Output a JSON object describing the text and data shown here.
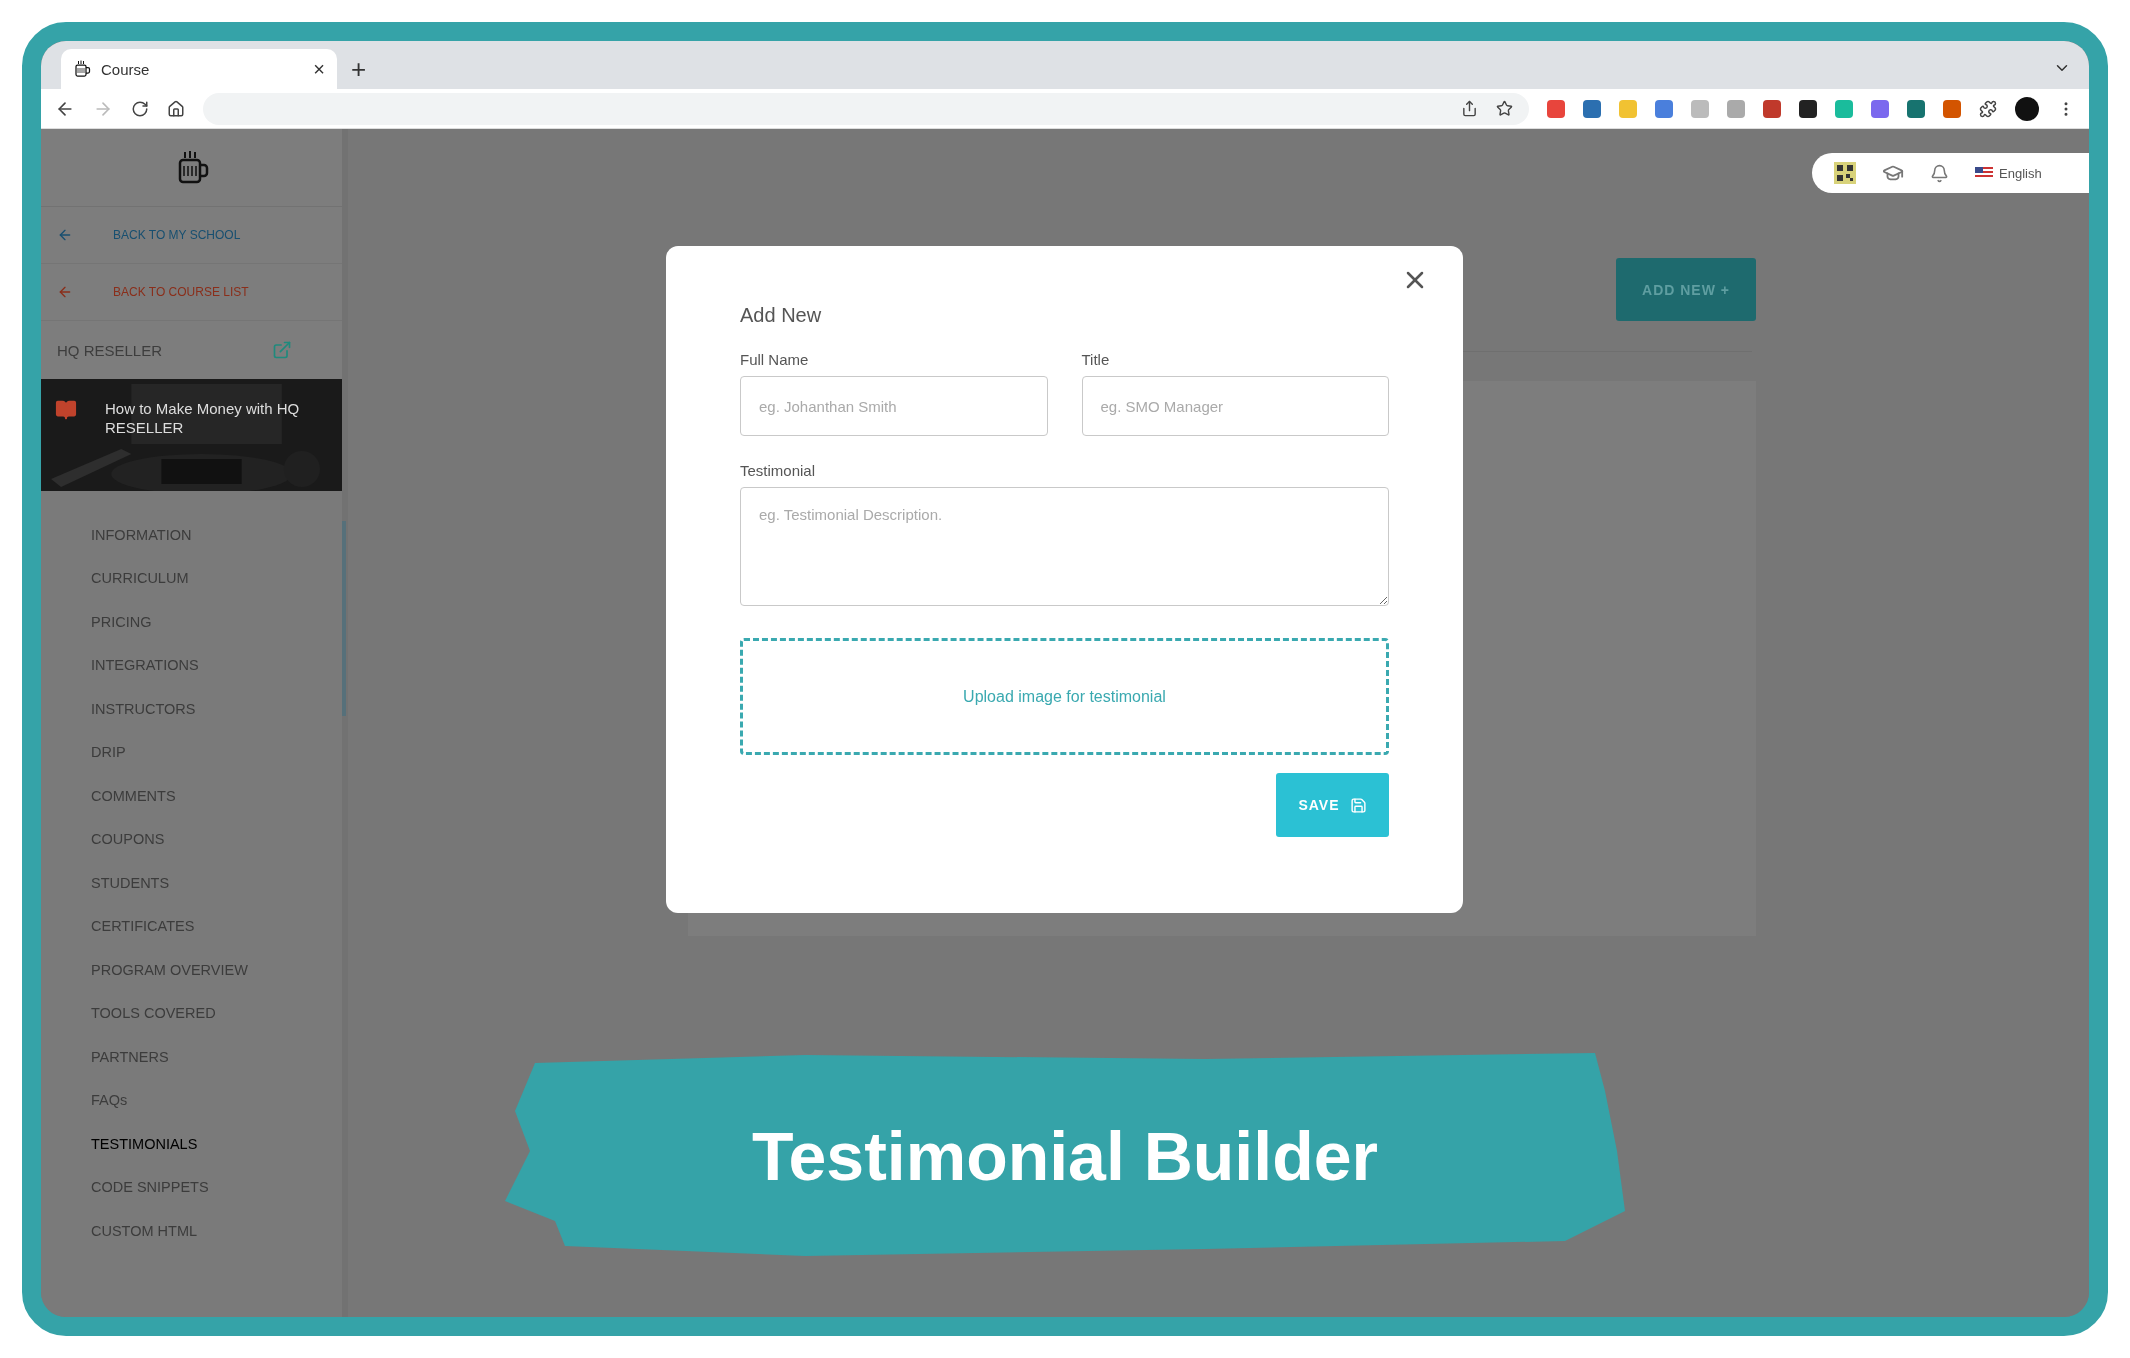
{
  "browser": {
    "tab_title": "Course",
    "tab_close": "×",
    "new_tab": "+"
  },
  "topbar": {
    "language": "English"
  },
  "sidebar": {
    "back_links": [
      {
        "label": "BACK TO MY SCHOOL",
        "color": "#174f70"
      },
      {
        "label": "BACK TO COURSE LIST",
        "color": "#8a2e1a"
      }
    ],
    "school_name": "HQ RESELLER",
    "course": {
      "title": "How to Make Money with HQ RESELLER",
      "kind": "picture"
    },
    "items": [
      {
        "label": "INFORMATION",
        "selected": false
      },
      {
        "label": "CURRICULUM",
        "selected": false
      },
      {
        "label": "PRICING",
        "selected": false
      },
      {
        "label": "INTEGRATIONS",
        "selected": false
      },
      {
        "label": "INSTRUCTORS",
        "selected": false
      },
      {
        "label": "DRIP",
        "selected": false
      },
      {
        "label": "COMMENTS",
        "selected": false
      },
      {
        "label": "COUPONS",
        "selected": false
      },
      {
        "label": "STUDENTS",
        "selected": false
      },
      {
        "label": "CERTIFICATES",
        "selected": false
      },
      {
        "label": "PROGRAM OVERVIEW",
        "selected": false
      },
      {
        "label": "TOOLS COVERED",
        "selected": false
      },
      {
        "label": "PARTNERS",
        "selected": false
      },
      {
        "label": "FAQs",
        "selected": false
      },
      {
        "label": "TESTIMONIALS",
        "selected": true
      },
      {
        "label": "CODE SNIPPETS",
        "selected": false
      },
      {
        "label": "CUSTOM HTML",
        "selected": false
      }
    ]
  },
  "main": {
    "add_button": "ADD NEW +"
  },
  "modal": {
    "title": "Add New",
    "fields": [
      {
        "label": "Full Name",
        "placeholder": "eg. Johanthan Smith",
        "kind": "input"
      },
      {
        "label": "Title",
        "placeholder": "eg. SMO Manager",
        "kind": "input"
      },
      {
        "label": "Testimonial",
        "placeholder": "eg. Testimonial Description.",
        "kind": "textarea"
      }
    ],
    "upload_label": "Upload image for testimonial",
    "save_label": "SAVE"
  },
  "banner": {
    "text": "Testimonial Builder"
  }
}
